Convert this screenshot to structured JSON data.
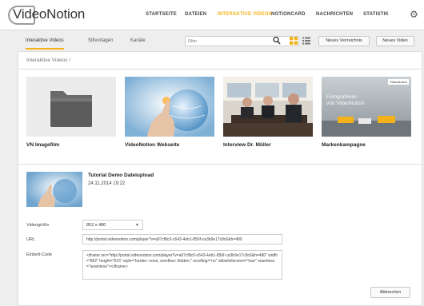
{
  "app": {
    "logo_text": "VideoNotion"
  },
  "nav": [
    {
      "label": "STARTSEITE",
      "active": false
    },
    {
      "label": "DATEIEN",
      "active": false
    },
    {
      "label": "INTERAKTIVE VIDEOS",
      "active": true
    },
    {
      "label": "NOTIONCARD",
      "active": false
    },
    {
      "label": "NACHRICHTEN",
      "active": false
    },
    {
      "label": "STATISTIK",
      "active": false
    }
  ],
  "colors": {
    "accent": "#f3b21a"
  },
  "tabs": [
    {
      "label": "Interaktive Videos",
      "active": true
    },
    {
      "label": "Stilvorlagen",
      "active": false
    },
    {
      "label": "Kanäle",
      "active": false
    }
  ],
  "search": {
    "placeholder": "Filter",
    "icon": "search-icon"
  },
  "view_toggle": {
    "grid_icon": "grid-icon",
    "list_icon": "list-icon",
    "selected": "grid"
  },
  "toolbar": {
    "new_folder": "Neues Verzeichnis",
    "new_video": "Neues Video"
  },
  "breadcrumb": "Interaktive Videos /",
  "items": [
    {
      "title": "VN Imagefilm",
      "kind": "folder"
    },
    {
      "title": "VideoNotion Webseite",
      "kind": "video"
    },
    {
      "title": "Interview Dr. Müller",
      "kind": "video"
    },
    {
      "title": "Markenkampagne",
      "kind": "video",
      "thumb_text": "Fotografieren\nvon VideoNotion",
      "badge": "VideoNotion"
    }
  ],
  "detail": {
    "title": "Tutorial Demo Dateiupload",
    "date": "24.11.2014 19:22",
    "size_label": "Videogröße",
    "size_value": "852 x 480",
    "url_label": "URL",
    "url_value": "http://portal.videonotion.com/player?v=a97cf8c0-c643-4eb1-856f-ca3b9e17c8c6&h=480",
    "embed_label": "Einbett-Code",
    "embed_value": "<iframe src=\"http://portal.videonotion.com/player?v=a97cf8c0-c643-4eb1-856f-ca3b9e17c8c6&h=480\" width=\"852\" height=\"516\" style=\"border: none; overflow: hidden;\" scrolling=\"no\" allowfullscreen=\"true\" seamless=\"seamless\"></iframe>",
    "close_label": "Abbrechen"
  }
}
